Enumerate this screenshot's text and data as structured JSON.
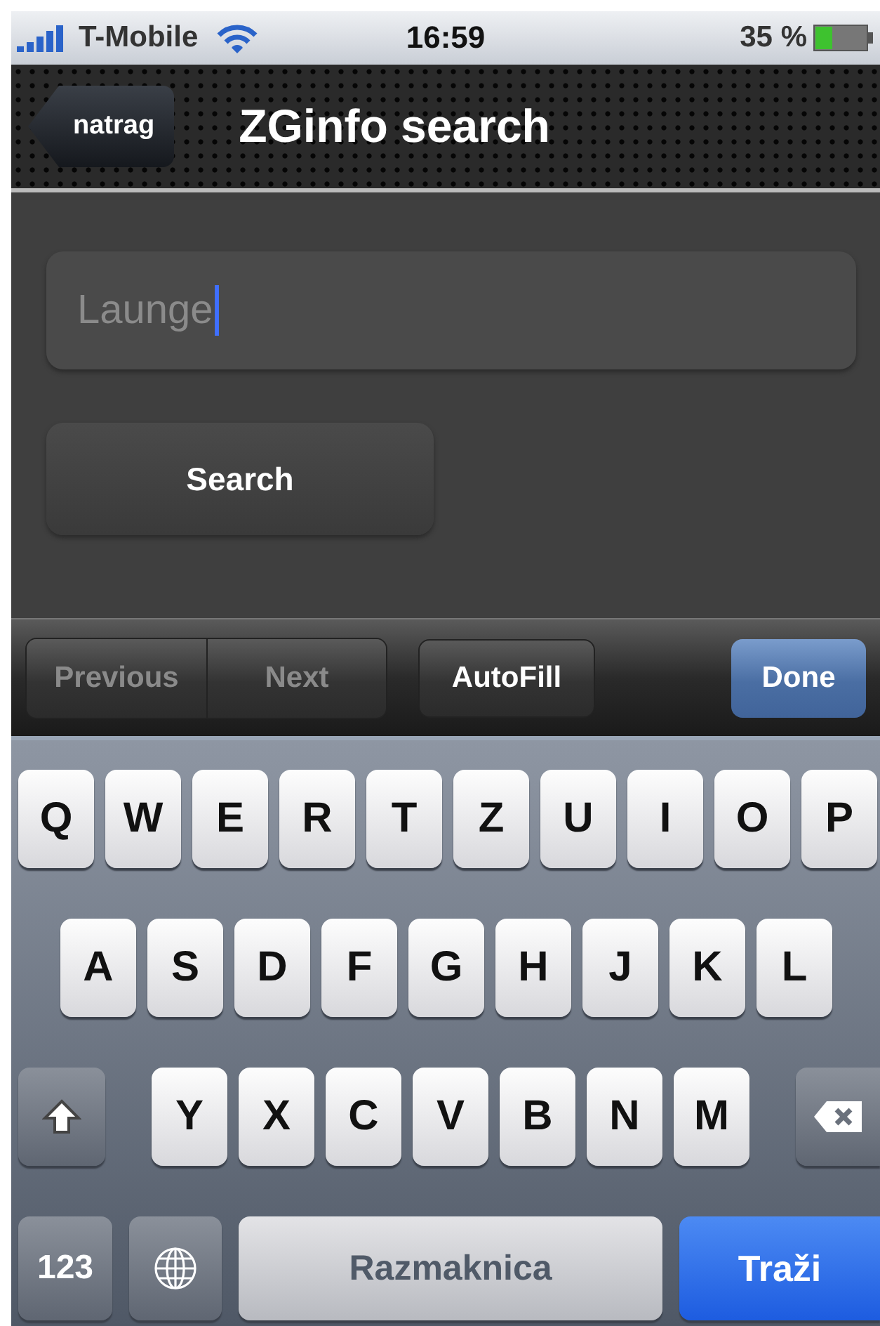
{
  "status_bar": {
    "carrier": "T-Mobile",
    "time": "16:59",
    "battery": "35 %"
  },
  "nav_bar": {
    "back": "natrag",
    "title": "ZGinfo search"
  },
  "search_field": {
    "value": "Launge",
    "focused": true
  },
  "search_button": "Search",
  "toolbar": {
    "buttons": [
      {
        "label": "Previous",
        "kind": "segment",
        "disabled": true
      },
      {
        "label": "Next",
        "kind": "segment",
        "disabled": true
      },
      {
        "label": "AutoFill",
        "kind": "plain",
        "disabled": false
      },
      {
        "label": "Done",
        "kind": "primary",
        "disabled": false
      }
    ]
  },
  "keyboard": {
    "rows": [
      [
        "Q",
        "W",
        "E",
        "R",
        "T",
        "Z",
        "U",
        "I",
        "O",
        "P"
      ],
      [
        "A",
        "S",
        "D",
        "F",
        "G",
        "H",
        "J",
        "K",
        "L"
      ],
      [
        "Y",
        "X",
        "C",
        "V",
        "B",
        "N",
        "M"
      ]
    ],
    "numbers_key": "123",
    "space_key": "Razmaknica",
    "return_key": "Traži"
  }
}
